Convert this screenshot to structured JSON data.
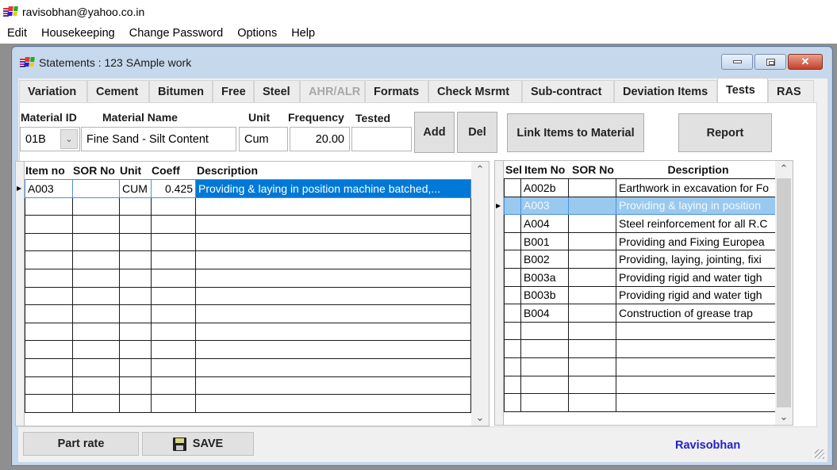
{
  "app": {
    "title": "ravisobhan@yahoo.co.in",
    "menu": [
      "Edit",
      "Housekeeping",
      "Change Password",
      "Options",
      "Help"
    ]
  },
  "window": {
    "title": "Statements : 123  SAmple work",
    "controls": {
      "minimize": "minimize",
      "maximize": "maximize",
      "close": "✕"
    }
  },
  "tabs": [
    {
      "label": "Variation",
      "state": "normal"
    },
    {
      "label": "Cement",
      "state": "normal"
    },
    {
      "label": "Bitumen",
      "state": "normal"
    },
    {
      "label": "Free",
      "state": "normal"
    },
    {
      "label": "Steel",
      "state": "normal"
    },
    {
      "label": "AHR/ALR",
      "state": "disabled"
    },
    {
      "label": "Formats",
      "state": "normal"
    },
    {
      "label": "Check Msrmt",
      "state": "normal"
    },
    {
      "label": "Sub-contract",
      "state": "normal"
    },
    {
      "label": "Deviation Items",
      "state": "normal"
    },
    {
      "label": "Tests",
      "state": "active"
    },
    {
      "label": "RAS",
      "state": "normal"
    }
  ],
  "form": {
    "labels": {
      "material_id": "Material ID",
      "material_name": "Material Name",
      "unit": "Unit",
      "frequency": "Frequency",
      "tested": "Tested"
    },
    "values": {
      "material_id": "01B",
      "material_name": "Fine Sand - Silt Content",
      "unit": "Cum",
      "frequency": "20.00",
      "tested": ""
    },
    "buttons": {
      "add": "Add",
      "del": "Del",
      "link": "Link Items to Material",
      "report": "Report"
    }
  },
  "left_grid": {
    "columns": [
      "Item no",
      "SOR No",
      "Unit",
      "Coeff",
      "Description"
    ],
    "rows": [
      {
        "item_no": "A003",
        "sor_no": "",
        "unit": "CUM",
        "coeff": "0.425",
        "description": "Providing & laying in position machine batched,...",
        "current": true
      }
    ]
  },
  "right_grid": {
    "columns": [
      "Sel",
      "Item No",
      "SOR No",
      "Description"
    ],
    "rows": [
      {
        "sel": "",
        "item_no": "A002b",
        "sor_no": "",
        "description": "Earthwork in excavation for Fo"
      },
      {
        "sel": "",
        "item_no": "A003",
        "sor_no": "",
        "description": "Providing & laying in position",
        "current": true
      },
      {
        "sel": "",
        "item_no": "A004",
        "sor_no": "",
        "description": "Steel reinforcement for all R.C"
      },
      {
        "sel": "",
        "item_no": "B001",
        "sor_no": "",
        "description": "Providing and Fixing Europea"
      },
      {
        "sel": "",
        "item_no": "B002",
        "sor_no": "",
        "description": "Providing, laying, jointing, fixi"
      },
      {
        "sel": "",
        "item_no": "B003a",
        "sor_no": "",
        "description": "Providing rigid and water tigh"
      },
      {
        "sel": "",
        "item_no": "B003b",
        "sor_no": "",
        "description": "Providing rigid and water tigh"
      },
      {
        "sel": "",
        "item_no": "B004",
        "sor_no": "",
        "description": " Construction of  grease trap"
      }
    ]
  },
  "footer": {
    "part_rate": "Part rate",
    "save": "SAVE",
    "user": "Ravisobhan"
  },
  "colors": {
    "selection": "#0078d7",
    "selection_inactive": "#99c9ef",
    "user_text": "#2222cc",
    "close_button": "#c5402a"
  }
}
